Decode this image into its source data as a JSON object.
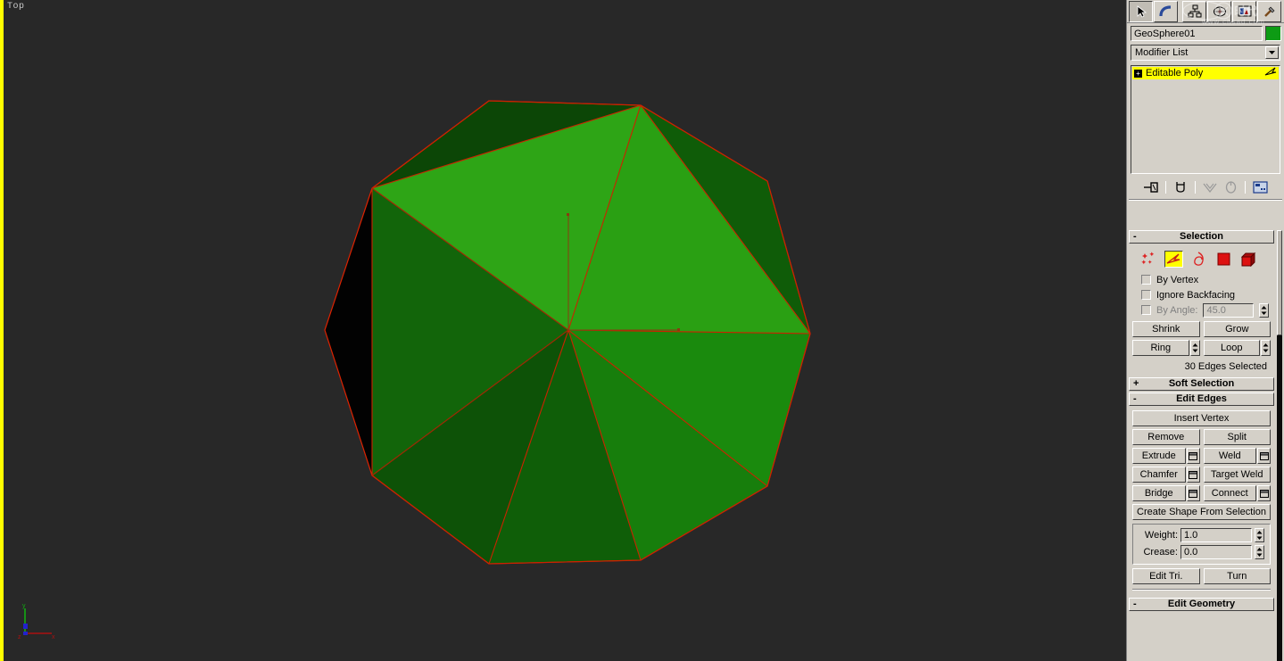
{
  "viewport": {
    "label": "Top",
    "background_color": "#282828",
    "active_border_color": "#ffff00",
    "axis_tripod": {
      "x_label": "x",
      "y_label": "y",
      "z_label": "z",
      "x_color": "#aa1111",
      "y_color": "#11aa11",
      "z_color": "#2222cc"
    },
    "object": {
      "name": "GeoSphere01",
      "edge_color": "#cc2200",
      "face_colors": [
        "#2ea516",
        "#1f8f0e",
        "#1a7a0c",
        "#14660a",
        "#0e4d07",
        "#0a3a05",
        "#062a03",
        "#000000"
      ]
    }
  },
  "command_panel": {
    "tabs": [
      {
        "name": "create-tab",
        "icon": "arrow-cursor-icon",
        "active": true
      },
      {
        "name": "modify-tab",
        "icon": "curve-bend-icon",
        "active": false
      },
      {
        "name": "hierarchy-tab",
        "icon": "hierarchy-icon",
        "active": false
      },
      {
        "name": "motion-tab",
        "icon": "motion-wheel-icon",
        "active": false
      },
      {
        "name": "display-tab",
        "icon": "display-monitor-icon",
        "active": false
      },
      {
        "name": "utilities-tab",
        "icon": "hammer-icon",
        "active": false
      }
    ],
    "object_name": "GeoSphere01",
    "object_color": "#0d9b14",
    "modifier_list_label": "Modifier List",
    "modifier_stack": [
      {
        "label": "Editable Poly",
        "selected": true,
        "expandable": "+"
      }
    ],
    "stack_tools": [
      {
        "name": "pin-stack-icon",
        "label": "Pin Stack"
      },
      {
        "name": "show-end-result-icon",
        "label": "Show End Result"
      },
      {
        "name": "make-unique-icon",
        "label": "Make Unique"
      },
      {
        "name": "remove-modifier-icon",
        "label": "Remove Modifier"
      },
      {
        "name": "configure-sets-icon",
        "label": "Configure Modifier Sets"
      }
    ],
    "rollouts": {
      "selection": {
        "title": "Selection",
        "sign": "-",
        "expanded": true,
        "subobject_levels": [
          {
            "name": "vertex",
            "label": "Vertex",
            "active": false
          },
          {
            "name": "edge",
            "label": "Edge",
            "active": true
          },
          {
            "name": "border",
            "label": "Border",
            "active": false
          },
          {
            "name": "polygon",
            "label": "Polygon",
            "active": false
          },
          {
            "name": "element",
            "label": "Element",
            "active": false
          }
        ],
        "by_vertex": {
          "label": "By Vertex",
          "checked": false,
          "disabled": false
        },
        "ignore_backfacing": {
          "label": "Ignore Backfacing",
          "checked": false,
          "disabled": false
        },
        "by_angle": {
          "label": "By Angle:",
          "checked": false,
          "disabled": true,
          "value": "45.0"
        },
        "shrink_label": "Shrink",
        "grow_label": "Grow",
        "ring_label": "Ring",
        "loop_label": "Loop",
        "status": "30 Edges Selected"
      },
      "soft_selection": {
        "title": "Soft Selection",
        "sign": "+",
        "expanded": false
      },
      "edit_edges": {
        "title": "Edit Edges",
        "sign": "-",
        "expanded": true,
        "insert_vertex_label": "Insert Vertex",
        "remove_label": "Remove",
        "split_label": "Split",
        "extrude_label": "Extrude",
        "weld_label": "Weld",
        "chamfer_label": "Chamfer",
        "target_weld_label": "Target Weld",
        "bridge_label": "Bridge",
        "connect_label": "Connect",
        "create_shape_label": "Create Shape From Selection",
        "weight_label": "Weight:",
        "weight_value": "1.0",
        "crease_label": "Crease:",
        "crease_value": "0.0",
        "edit_tri_label": "Edit Tri.",
        "turn_label": "Turn"
      },
      "edit_geometry": {
        "title": "Edit Geometry",
        "sign": "-",
        "expanded": true
      }
    }
  },
  "watermark": {
    "text": "www.chsad.com"
  }
}
